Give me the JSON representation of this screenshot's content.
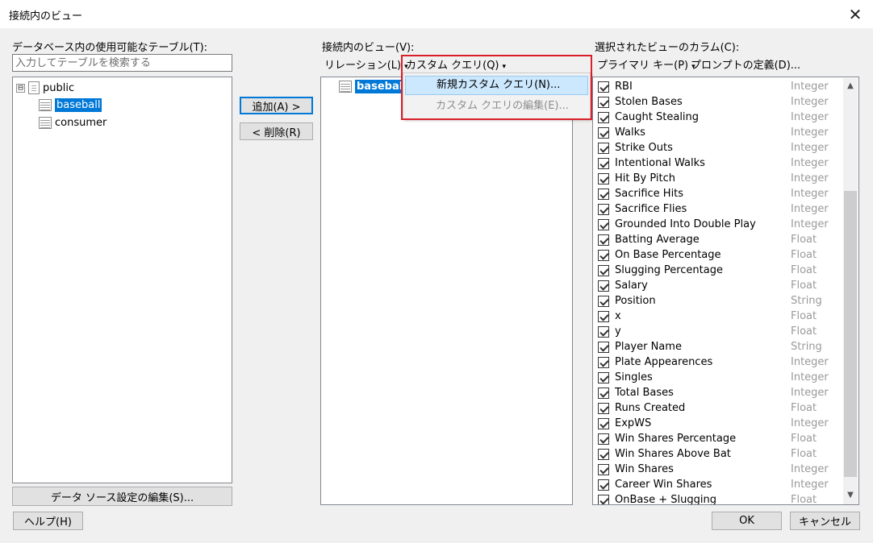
{
  "window": {
    "title": "接続内のビュー",
    "close_glyph": "✕"
  },
  "left": {
    "label": "データベース内の使用可能なテーブル(T):",
    "search_placeholder": "入力してテーブルを検索する",
    "tree": {
      "root": {
        "expander": "⊟",
        "label": "public"
      },
      "items": [
        {
          "label": "baseball",
          "selected": true
        },
        {
          "label": "consumer",
          "selected": false
        }
      ]
    },
    "edit_datasource_button": "データ ソース設定の編集(S)..."
  },
  "middle_buttons": {
    "add": "追加(A) >",
    "remove": "< 削除(R)"
  },
  "center": {
    "label": "接続内のビュー(V):",
    "menu": {
      "relations": "リレーション(L)",
      "custom_query": "カスタム クエリ(Q)",
      "caret": "▾"
    },
    "tree_items": [
      {
        "label": "baseball",
        "selected": true
      }
    ],
    "popup": {
      "new": "新規カスタム クエリ(N)...",
      "edit": "カスタム クエリの編集(E)..."
    }
  },
  "right": {
    "label": "選択されたビューのカラム(C):",
    "menu": {
      "primary_key": "プライマリ キー(P)",
      "prompt": "プロンプトの定義(D)...",
      "caret": "▾"
    },
    "columns": [
      {
        "name": "RBI",
        "type": "Integer"
      },
      {
        "name": "Stolen Bases",
        "type": "Integer"
      },
      {
        "name": "Caught Stealing",
        "type": "Integer"
      },
      {
        "name": "Walks",
        "type": "Integer"
      },
      {
        "name": "Strike Outs",
        "type": "Integer"
      },
      {
        "name": "Intentional Walks",
        "type": "Integer"
      },
      {
        "name": "Hit By Pitch",
        "type": "Integer"
      },
      {
        "name": "Sacrifice Hits",
        "type": "Integer"
      },
      {
        "name": "Sacrifice Flies",
        "type": "Integer"
      },
      {
        "name": "Grounded Into Double Play",
        "type": "Integer"
      },
      {
        "name": "Batting Average",
        "type": "Float"
      },
      {
        "name": "On Base Percentage",
        "type": "Float"
      },
      {
        "name": "Slugging Percentage",
        "type": "Float"
      },
      {
        "name": "Salary",
        "type": "Float"
      },
      {
        "name": "Position",
        "type": "String"
      },
      {
        "name": "x",
        "type": "Float"
      },
      {
        "name": "y",
        "type": "Float"
      },
      {
        "name": "Player Name",
        "type": "String"
      },
      {
        "name": "Plate Appearences",
        "type": "Integer"
      },
      {
        "name": "Singles",
        "type": "Integer"
      },
      {
        "name": "Total Bases",
        "type": "Integer"
      },
      {
        "name": "Runs Created",
        "type": "Float"
      },
      {
        "name": "ExpWS",
        "type": "Integer"
      },
      {
        "name": "Win Shares Percentage",
        "type": "Float"
      },
      {
        "name": "Win Shares Above Bat",
        "type": "Float"
      },
      {
        "name": "Win Shares",
        "type": "Integer"
      },
      {
        "name": "Career Win Shares",
        "type": "Integer"
      },
      {
        "name": "OnBase + Slugging",
        "type": "Float"
      }
    ],
    "scroll_up": "▲",
    "scroll_down": "▼"
  },
  "footer": {
    "help": "ヘルプ(H)",
    "ok": "OK",
    "cancel": "キャンセル"
  },
  "colors": {
    "selection": "#0078d7",
    "highlight_box": "#d9202a",
    "menu_hover": "#cce8ff"
  }
}
